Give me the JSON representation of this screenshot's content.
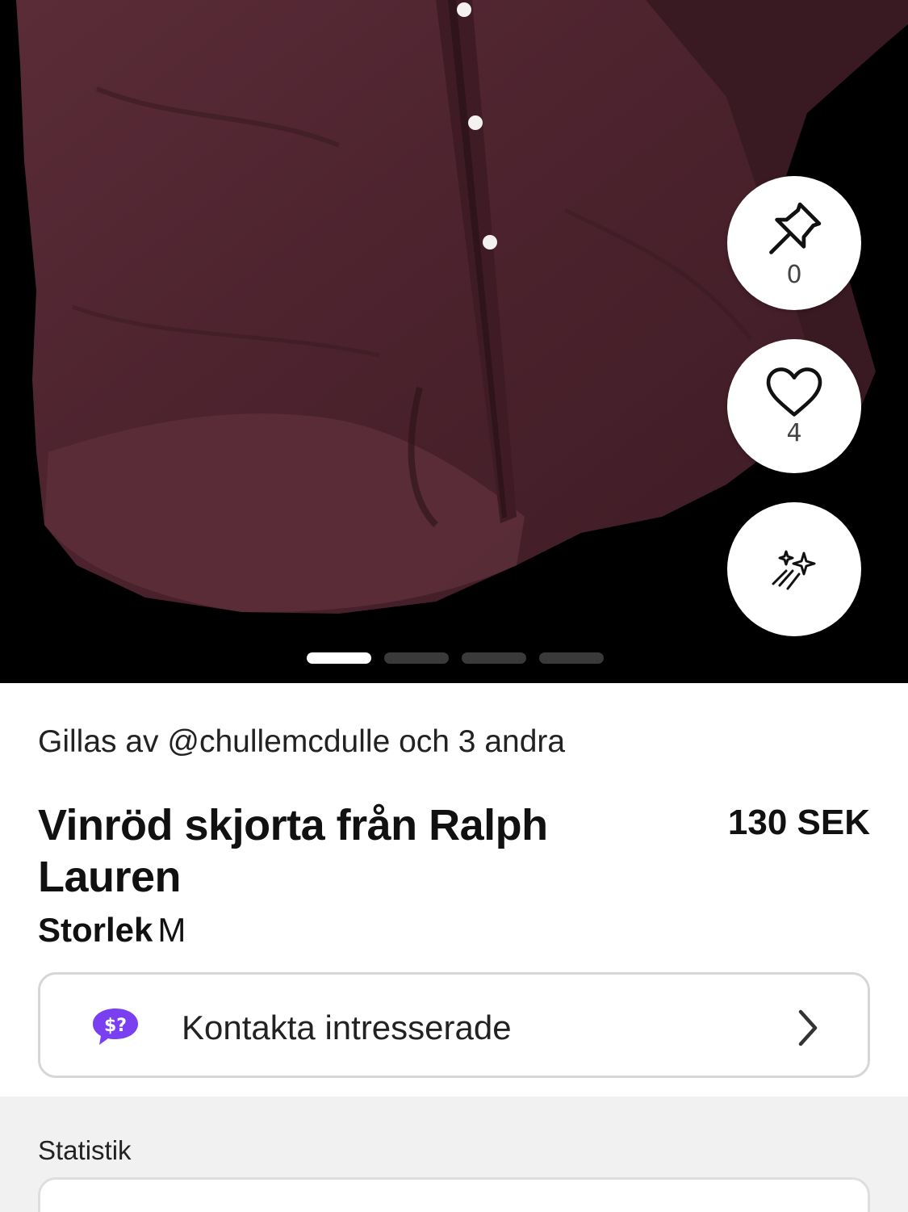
{
  "listing": {
    "liked_by_text": "Gillas av @chullemcdulle och 3 andra",
    "title": "Vinröd skjorta från Ralph Lauren",
    "price": "130 SEK",
    "size_label": "Storlek",
    "size_value": "M"
  },
  "actions": {
    "pin_count": "0",
    "like_count": "4"
  },
  "gallery": {
    "image_count": 4,
    "active_index": 0
  },
  "contact": {
    "label": "Kontakta intresserade",
    "badge_text": "$?"
  },
  "stats": {
    "title": "Statistik"
  },
  "colors": {
    "shirt": "#4e2530",
    "accent_purple": "#7b3ff2",
    "border": "#d6d6d6",
    "stats_bg": "#f1f1f1"
  }
}
